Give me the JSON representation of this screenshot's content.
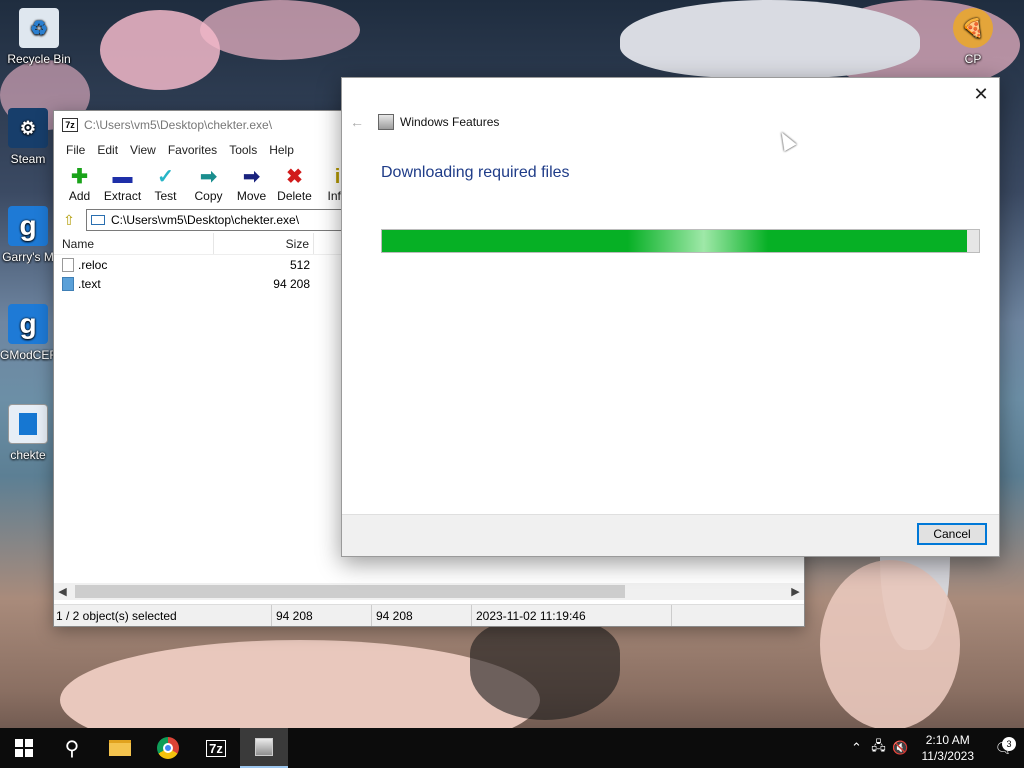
{
  "desktop": {
    "icons": [
      {
        "label": "Recycle Bin"
      },
      {
        "label": "Steam"
      },
      {
        "label": "Garry's M"
      },
      {
        "label": "GModCEF"
      },
      {
        "label": "chekte"
      },
      {
        "label": "CP"
      }
    ]
  },
  "sevenzip": {
    "title": "C:\\Users\\vm5\\Desktop\\chekter.exe\\",
    "app_icon": "7z",
    "menu": [
      "File",
      "Edit",
      "View",
      "Favorites",
      "Tools",
      "Help"
    ],
    "toolbar": [
      {
        "label": "Add",
        "icon": "plus-icon",
        "color": "#1aa31a"
      },
      {
        "label": "Extract",
        "icon": "minus-icon",
        "color": "#1e2fa8"
      },
      {
        "label": "Test",
        "icon": "check-icon",
        "color": "#27b5c7"
      },
      {
        "label": "Copy",
        "icon": "copy-arrow-icon",
        "color": "#1a8e8e"
      },
      {
        "label": "Move",
        "icon": "move-arrow-icon",
        "color": "#1a237e"
      },
      {
        "label": "Delete",
        "icon": "delete-x-icon",
        "color": "#d11b1b"
      },
      {
        "label": "Info",
        "icon": "info-icon",
        "color": "#b59a00"
      }
    ],
    "address": "C:\\Users\\vm5\\Desktop\\chekter.exe\\",
    "columns": {
      "name": "Name",
      "size": "Size"
    },
    "files": [
      {
        "name": ".reloc",
        "size": "512"
      },
      {
        "name": ".text",
        "size": "94 208"
      }
    ],
    "status": {
      "selection": "1 / 2 object(s) selected",
      "size": "94 208",
      "packed": "94 208",
      "modified": "2023-11-02 11:19:46"
    }
  },
  "dialog": {
    "title": "Windows Features",
    "heading": "Downloading required files",
    "progress_percent": 98,
    "cancel_label": "Cancel",
    "close_glyph": "✕",
    "back_glyph": "←"
  },
  "taskbar": {
    "time": "2:10 AM",
    "date": "11/3/2023",
    "notification_count": "3",
    "apps": [
      "start-icon",
      "search-icon",
      "file-explorer-icon",
      "chrome-icon",
      "7zip-icon",
      "windows-features-icon"
    ]
  }
}
